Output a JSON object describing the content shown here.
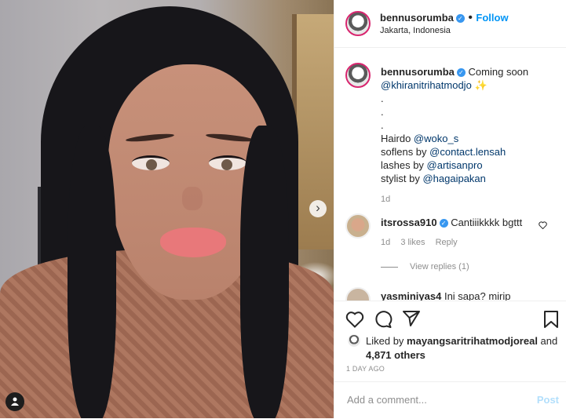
{
  "post": {
    "author": "bennusorumba",
    "location": "Jakarta, Indonesia",
    "follow_label": "Follow",
    "separator": "•"
  },
  "caption": {
    "author": "bennusorumba",
    "text": "Coming soon",
    "mention": "@khiranitrihatmodjo",
    "emoji": "✨",
    "dots": [
      ".",
      ".",
      "."
    ],
    "hairdo_label": "Hairdo ",
    "hairdo_mention": "@woko_s",
    "soflens_label": "soflens by ",
    "soflens_mention": "@contact.lensah",
    "lashes_label": "lashes by ",
    "lashes_mention": "@artisanpro",
    "stylist_label": "stylist by ",
    "stylist_mention": "@hagaipakan",
    "time": "1d"
  },
  "comments": [
    {
      "user": "itsrossa910",
      "text": "Cantiiikkkk bgttt",
      "time": "1d",
      "likes": "3 likes",
      "reply": "Reply",
      "view_replies": "View replies (1)"
    },
    {
      "user": "yasminiyas4",
      "text": "Ini sapa? mirip"
    }
  ],
  "likes": {
    "prefix": "Liked by ",
    "user": "mayangsaritrihatmodjoreal",
    "and": " and",
    "count": "4,871 others"
  },
  "timestamp": "1 DAY AGO",
  "add_comment": {
    "placeholder": "Add a comment...",
    "post_label": "Post"
  },
  "icons": {
    "like": "heart-icon",
    "comment": "comment-icon",
    "share": "share-icon",
    "save": "bookmark-icon",
    "next": "chevron-right-icon",
    "tag": "user-tag-icon"
  },
  "colors": {
    "accent": "#0095f6",
    "link": "#00376b",
    "muted": "#8e8e8e",
    "verified": "#3897f0"
  }
}
